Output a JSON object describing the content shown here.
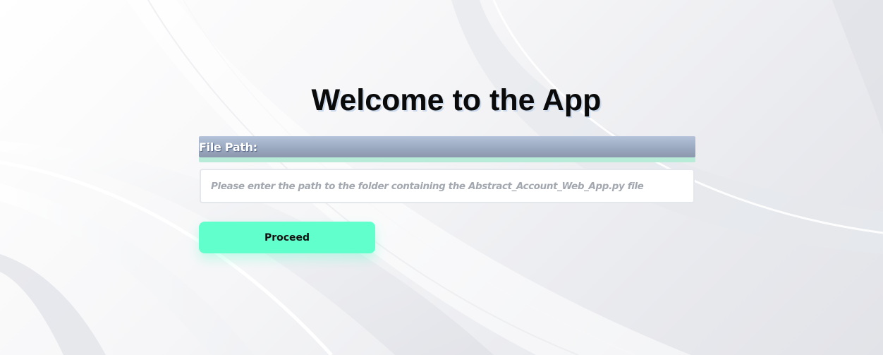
{
  "page": {
    "title": "Welcome to the App"
  },
  "form": {
    "label": "File Path:",
    "input_value": "",
    "input_placeholder": "Please enter the path to the folder containing the Abstract_Account_Web_App.py file",
    "button_label": "Proceed"
  },
  "colors": {
    "button": "#61ffcb",
    "label_bar": "#9ba9c1",
    "label_accent": "#b9ecd8",
    "title_text": "#0a0a0a"
  }
}
